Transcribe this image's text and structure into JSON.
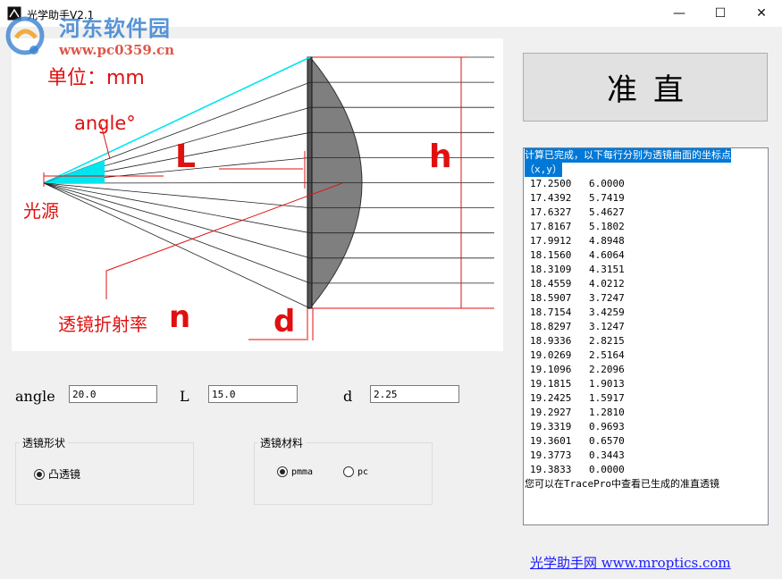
{
  "window": {
    "title": "光学助手V2.1",
    "controls": {
      "minimize": "—",
      "maximize": "☐",
      "close": "✕"
    }
  },
  "watermark": {
    "name": "河东软件园",
    "url": "www.pc0359.cn"
  },
  "diagram": {
    "unit_label": "单位：mm",
    "angle_label": "angle°",
    "length_label": "L",
    "height_label": "h",
    "source_label": "光源",
    "index_label": "透镜折射率",
    "index_symbol": "n",
    "thickness_label": "d",
    "colors": {
      "annotation": "#e01010",
      "beam": "#00e5ee",
      "lens": "#7f7f7f"
    }
  },
  "collimate_button": {
    "label": "准直"
  },
  "output": {
    "header": "计算已完成，以下每行分别为透镜曲面的坐标点",
    "subheader": "（x,y）",
    "points": [
      [
        "17.2500",
        "6.0000"
      ],
      [
        "17.4392",
        "5.7419"
      ],
      [
        "17.6327",
        "5.4627"
      ],
      [
        "17.8167",
        "5.1802"
      ],
      [
        "17.9912",
        "4.8948"
      ],
      [
        "18.1560",
        "4.6064"
      ],
      [
        "18.3109",
        "4.3151"
      ],
      [
        "18.4559",
        "4.0212"
      ],
      [
        "18.5907",
        "3.7247"
      ],
      [
        "18.7154",
        "3.4259"
      ],
      [
        "18.8297",
        "3.1247"
      ],
      [
        "18.9336",
        "2.8215"
      ],
      [
        "19.0269",
        "2.5164"
      ],
      [
        "19.1096",
        "2.2096"
      ],
      [
        "19.1815",
        "1.9013"
      ],
      [
        "19.2425",
        "1.5917"
      ],
      [
        "19.2927",
        "1.2810"
      ],
      [
        "19.3319",
        "0.9693"
      ],
      [
        "19.3601",
        "0.6570"
      ],
      [
        "19.3773",
        "0.3443"
      ],
      [
        "19.3833",
        "0.0000"
      ]
    ],
    "footer": "您可以在TracePro中查看已生成的准直透镜"
  },
  "params": {
    "angle": {
      "label": "angle",
      "value": "20.0"
    },
    "L": {
      "label": "L",
      "value": "15.0"
    },
    "d": {
      "label": "d",
      "value": "2.25"
    }
  },
  "lens_shape": {
    "title": "透镜形状",
    "option": "凸透镜",
    "selected": true
  },
  "lens_material": {
    "title": "透镜材料",
    "options": [
      {
        "label": "pmma",
        "selected": true
      },
      {
        "label": "pc",
        "selected": false
      }
    ]
  },
  "footer_link": "光学助手网 www.mroptics.com"
}
